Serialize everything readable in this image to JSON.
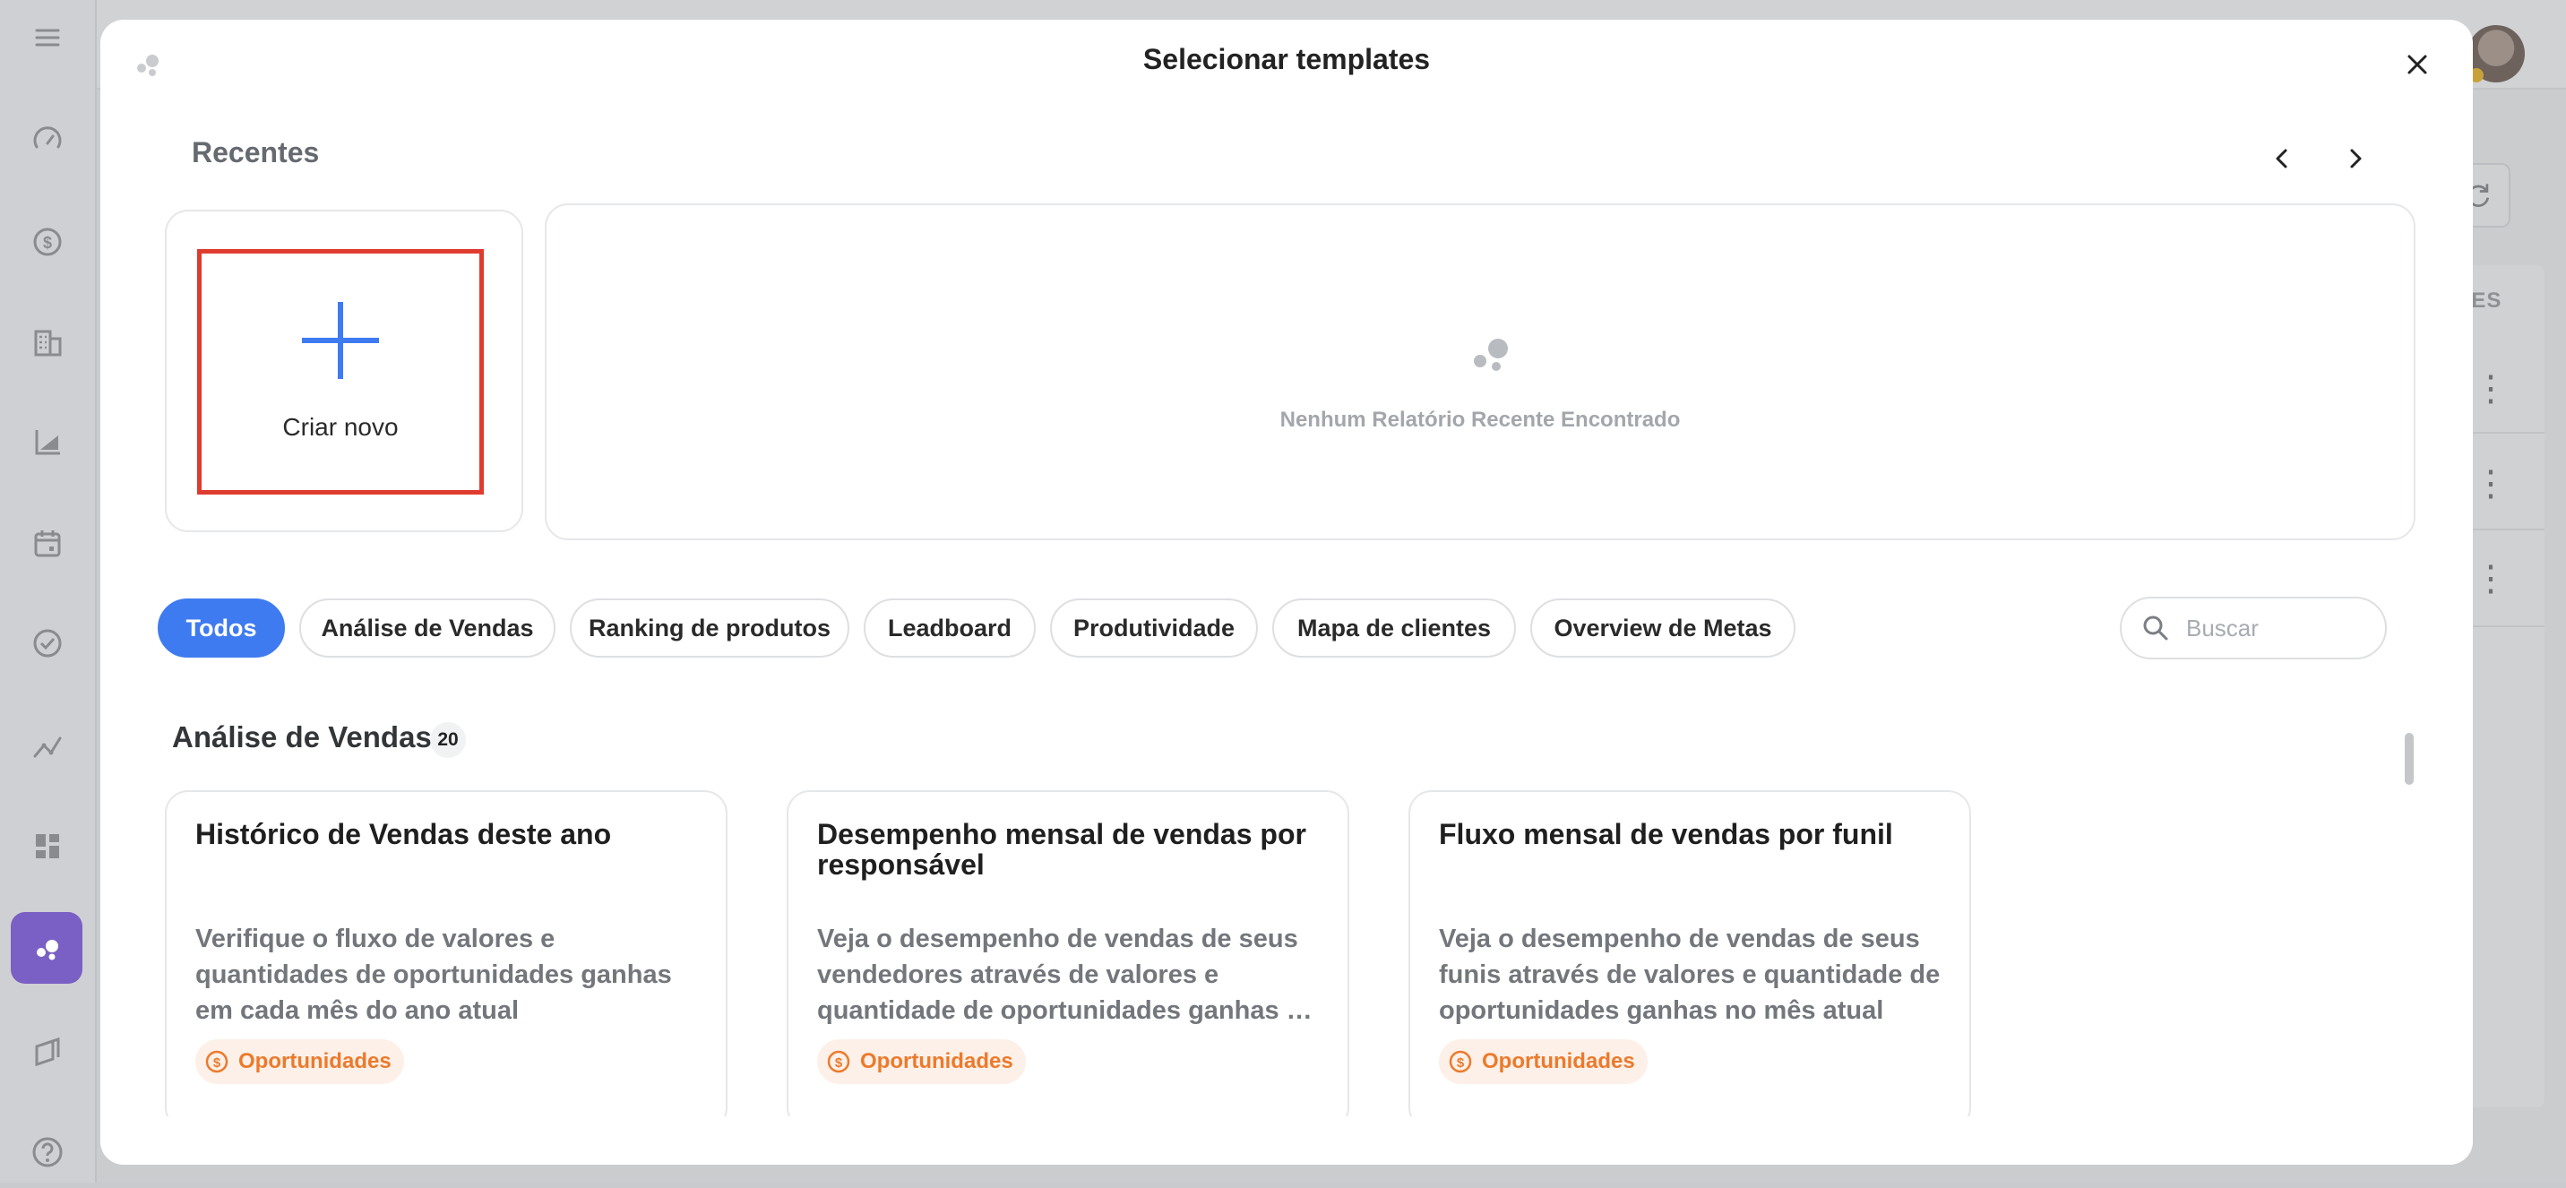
{
  "modal": {
    "title": "Selecionar templates",
    "recent_heading": "Recentes",
    "create_new_label": "Criar novo",
    "empty_message": "Nenhum Relatório Recente Encontrado"
  },
  "filters": [
    {
      "label": "Todos",
      "active": true
    },
    {
      "label": "Análise de Vendas",
      "active": false
    },
    {
      "label": "Ranking de produtos",
      "active": false
    },
    {
      "label": "Leadboard",
      "active": false
    },
    {
      "label": "Produtividade",
      "active": false
    },
    {
      "label": "Mapa de clientes",
      "active": false
    },
    {
      "label": "Overview de Metas",
      "active": false
    }
  ],
  "search": {
    "placeholder": "Buscar"
  },
  "section": {
    "title": "Análise de Vendas",
    "count": "20"
  },
  "cards": [
    {
      "title": "Histórico de Vendas deste ano",
      "description": "Verifique o fluxo de valores e quantidades de oportunidades ganhas em cada mês do ano atual",
      "tag": "Oportunidades"
    },
    {
      "title": "Desempenho mensal de vendas por responsável",
      "description": "Veja o desempenho de vendas de seus vendedores através de valores e quantidade de oportunidades ganhas no mês atual",
      "tag": "Oportunidades"
    },
    {
      "title": "Fluxo mensal de vendas por funil",
      "description": "Veja o desempenho de vendas de seus funis através de valores e quantidade de oportunidades ganhas no mês atual",
      "tag": "Oportunidades"
    }
  ],
  "background": {
    "column_header": "DES"
  },
  "colors": {
    "accent": "#3f7bf0",
    "highlight_border": "#e03b2f",
    "tag_text": "#ec7a2c",
    "tag_bg": "#fdf0e8",
    "sidebar_active": "#7a5fc4"
  }
}
